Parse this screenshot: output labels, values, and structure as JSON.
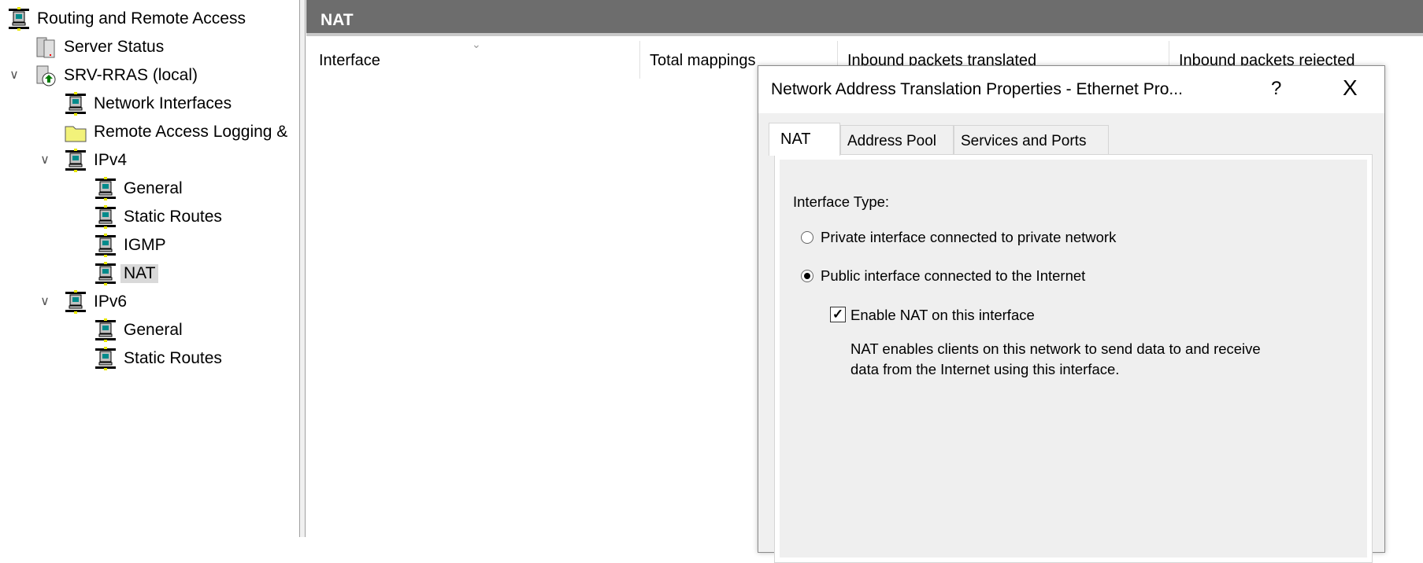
{
  "tree": {
    "items": [
      {
        "label": "Routing and Remote Access",
        "icon": "network-computer-icon",
        "level": 0
      },
      {
        "label": "Server Status",
        "icon": "server-icon",
        "level": 1
      },
      {
        "label": "SRV-RRAS (local)",
        "icon": "server-up-icon",
        "level": 1,
        "expanded": true
      },
      {
        "label": "Network Interfaces",
        "icon": "network-computer-icon",
        "level": 2
      },
      {
        "label": "Remote Access Logging &",
        "icon": "folder-icon",
        "level": 2
      },
      {
        "label": "IPv4",
        "icon": "network-computer-icon",
        "level": 2,
        "expanded": true
      },
      {
        "label": "General",
        "icon": "network-computer-icon",
        "level": 3
      },
      {
        "label": "Static Routes",
        "icon": "network-computer-icon",
        "level": 3
      },
      {
        "label": "IGMP",
        "icon": "network-computer-icon",
        "level": 3
      },
      {
        "label": "NAT",
        "icon": "network-computer-icon",
        "level": 3,
        "selected": true
      },
      {
        "label": "IPv6",
        "icon": "network-computer-icon",
        "level": 2,
        "expanded": true
      },
      {
        "label": "General",
        "icon": "network-computer-icon",
        "level": 3
      },
      {
        "label": "Static Routes",
        "icon": "network-computer-icon",
        "level": 3
      }
    ]
  },
  "main": {
    "title": "NAT",
    "columns": [
      "Interface",
      "Total mappings",
      "Inbound packets translated",
      "Inbound packets rejected"
    ]
  },
  "dialog": {
    "title": "Network Address Translation Properties - Ethernet Pro...",
    "help": "?",
    "close": "X",
    "tabs": [
      "NAT",
      "Address Pool",
      "Services and Ports"
    ],
    "interface_type_label": "Interface Type:",
    "radio_private": "Private interface connected to private network",
    "radio_public": "Public interface connected to the Internet",
    "selected": "public",
    "enable_nat": "Enable NAT on this interface",
    "enable_nat_checked": true,
    "desc_line1": "NAT enables clients on this network to send data to and receive",
    "desc_line2": "data from the Internet using this interface."
  }
}
